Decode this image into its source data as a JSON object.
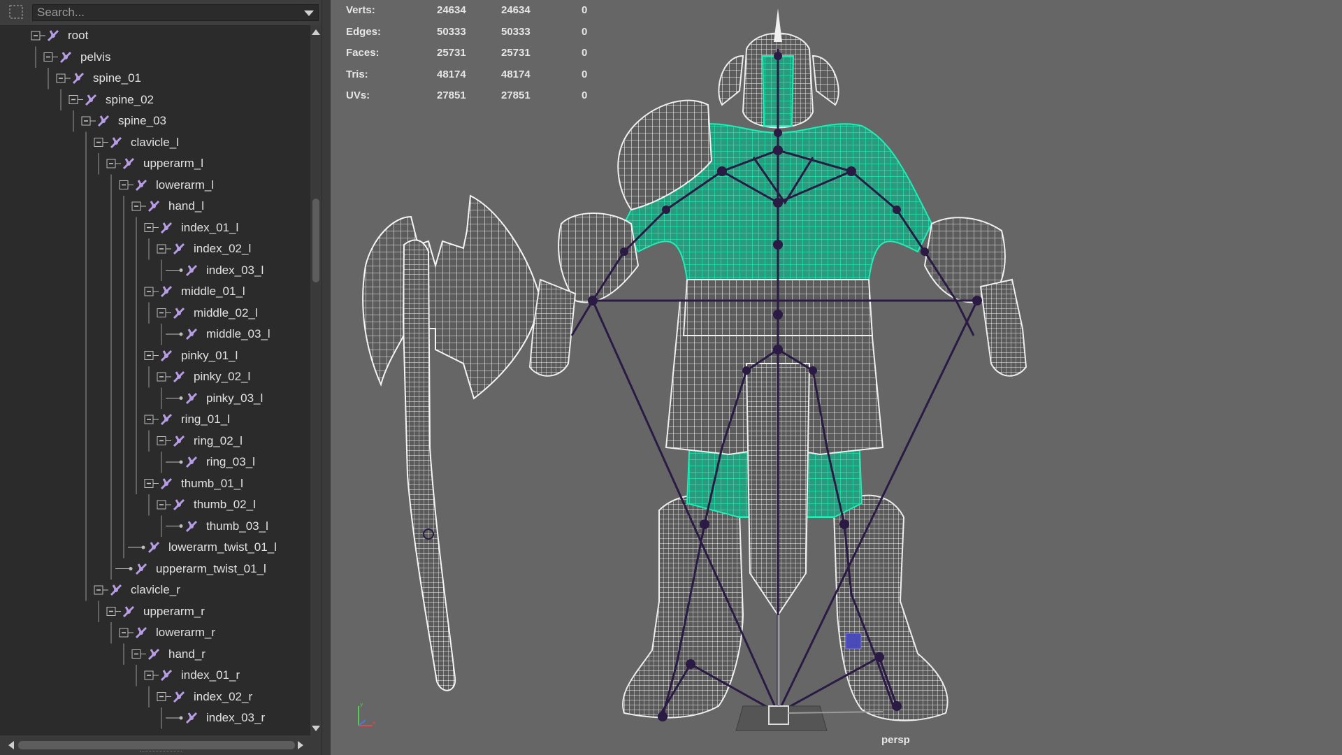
{
  "outliner": {
    "search": {
      "placeholder": "Search..."
    },
    "tree": [
      {
        "label": "root",
        "depth": 0,
        "expandable": true
      },
      {
        "label": "pelvis",
        "depth": 1,
        "expandable": true
      },
      {
        "label": "spine_01",
        "depth": 2,
        "expandable": true
      },
      {
        "label": "spine_02",
        "depth": 3,
        "expandable": true
      },
      {
        "label": "spine_03",
        "depth": 4,
        "expandable": true
      },
      {
        "label": "clavicle_l",
        "depth": 5,
        "expandable": true
      },
      {
        "label": "upperarm_l",
        "depth": 6,
        "expandable": true
      },
      {
        "label": "lowerarm_l",
        "depth": 7,
        "expandable": true
      },
      {
        "label": "hand_l",
        "depth": 8,
        "expandable": true
      },
      {
        "label": "index_01_l",
        "depth": 9,
        "expandable": true
      },
      {
        "label": "index_02_l",
        "depth": 10,
        "expandable": true
      },
      {
        "label": "index_03_l",
        "depth": 11,
        "expandable": false
      },
      {
        "label": "middle_01_l",
        "depth": 9,
        "expandable": true
      },
      {
        "label": "middle_02_l",
        "depth": 10,
        "expandable": true
      },
      {
        "label": "middle_03_l",
        "depth": 11,
        "expandable": false
      },
      {
        "label": "pinky_01_l",
        "depth": 9,
        "expandable": true
      },
      {
        "label": "pinky_02_l",
        "depth": 10,
        "expandable": true
      },
      {
        "label": "pinky_03_l",
        "depth": 11,
        "expandable": false
      },
      {
        "label": "ring_01_l",
        "depth": 9,
        "expandable": true
      },
      {
        "label": "ring_02_l",
        "depth": 10,
        "expandable": true
      },
      {
        "label": "ring_03_l",
        "depth": 11,
        "expandable": false
      },
      {
        "label": "thumb_01_l",
        "depth": 9,
        "expandable": true
      },
      {
        "label": "thumb_02_l",
        "depth": 10,
        "expandable": true
      },
      {
        "label": "thumb_03_l",
        "depth": 11,
        "expandable": false
      },
      {
        "label": "lowerarm_twist_01_l",
        "depth": 8,
        "expandable": false
      },
      {
        "label": "upperarm_twist_01_l",
        "depth": 7,
        "expandable": false
      },
      {
        "label": "clavicle_r",
        "depth": 5,
        "expandable": true
      },
      {
        "label": "upperarm_r",
        "depth": 6,
        "expandable": true
      },
      {
        "label": "lowerarm_r",
        "depth": 7,
        "expandable": true
      },
      {
        "label": "hand_r",
        "depth": 8,
        "expandable": true
      },
      {
        "label": "index_01_r",
        "depth": 9,
        "expandable": true
      },
      {
        "label": "index_02_r",
        "depth": 10,
        "expandable": true
      },
      {
        "label": "index_03_r",
        "depth": 11,
        "expandable": false
      }
    ]
  },
  "viewport": {
    "stats": [
      {
        "label": "Verts:",
        "v1": "24634",
        "v2": "24634",
        "v3": "0"
      },
      {
        "label": "Edges:",
        "v1": "50333",
        "v2": "50333",
        "v3": "0"
      },
      {
        "label": "Faces:",
        "v1": "25731",
        "v2": "25731",
        "v3": "0"
      },
      {
        "label": "Tris:",
        "v1": "48174",
        "v2": "48174",
        "v3": "0"
      },
      {
        "label": "UVs:",
        "v1": "27851",
        "v2": "27851",
        "v3": "0"
      }
    ],
    "camera": "persp",
    "colors": {
      "background": "#666666",
      "wireframe": "#ffffff",
      "selected_mesh": "#1de9b0",
      "skeleton": "#2a1a44",
      "joint_icon": "#b79ce6"
    }
  }
}
